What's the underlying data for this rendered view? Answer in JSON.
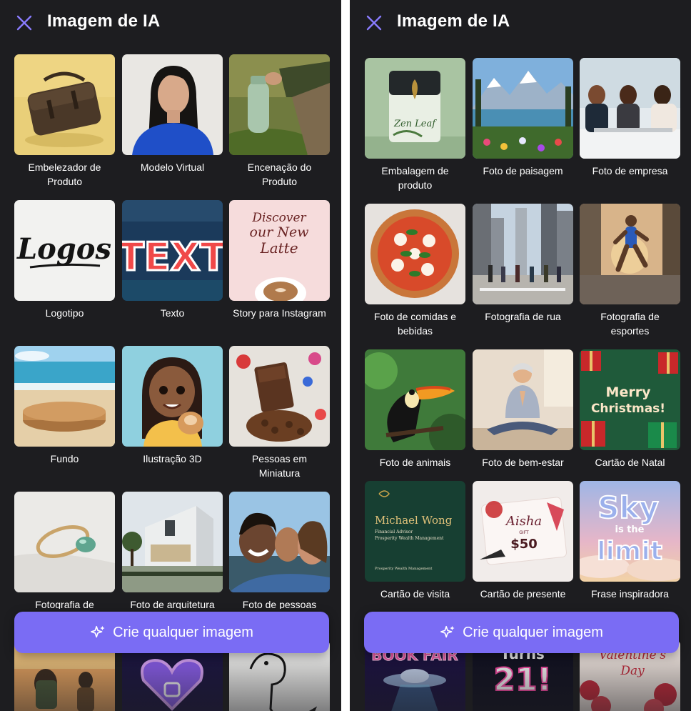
{
  "left": {
    "title": "Imagem de IA",
    "tiles": [
      {
        "label": "Embelezador de Produto"
      },
      {
        "label": "Modelo Virtual"
      },
      {
        "label": "Encenação do Produto"
      },
      {
        "label": "Logotipo",
        "art_text": "Logos"
      },
      {
        "label": "Texto",
        "art_text": "TEXT"
      },
      {
        "label": "Story para Instagram",
        "art_lines": [
          "Discover",
          "our New",
          "Latte"
        ]
      },
      {
        "label": "Fundo"
      },
      {
        "label": "Ilustração 3D"
      },
      {
        "label": "Pessoas em Miniatura"
      },
      {
        "label": "Fotografia de"
      },
      {
        "label": "Foto de arquitetura"
      },
      {
        "label": "Foto de pessoas"
      }
    ],
    "cta_label": "Crie qualquer imagem"
  },
  "right": {
    "title": "Imagem de IA",
    "tiles": [
      {
        "label": "Embalagem de produto",
        "art_text": "Zen Leaf"
      },
      {
        "label": "Foto de paisagem"
      },
      {
        "label": "Foto de empresa"
      },
      {
        "label": "Foto de comidas e bebidas"
      },
      {
        "label": "Fotografia de rua"
      },
      {
        "label": "Fotografia de esportes"
      },
      {
        "label": "Foto de animais"
      },
      {
        "label": "Foto de bem-estar"
      },
      {
        "label": "Cartão de Natal",
        "art_lines": [
          "Merry",
          "Christmas!"
        ]
      },
      {
        "label": "Cartão de visita",
        "art_lines": [
          "Michael Wong",
          "Financial Advisor",
          "Prosperity Wealth Management",
          "Prosperity Wealth Management"
        ]
      },
      {
        "label": "Cartão de presente",
        "art_lines": [
          "Aisha",
          "GIFT",
          "$50"
        ]
      },
      {
        "label": "Frase inspiradora",
        "art_lines": [
          "Sky",
          "is the",
          "limit"
        ]
      }
    ],
    "peek_texts": [
      "BOOK FAIR",
      "Turns",
      "21!",
      "Valentine's",
      "Day"
    ],
    "cta_label": "Crie qualquer imagem"
  },
  "colors": {
    "panel_bg": "#1d1d20",
    "accent": "#7a6cf4",
    "close_icon": "#8a7cff",
    "text": "#ffffff"
  },
  "icons": {
    "close": "close-icon",
    "sparkle": "sparkle-icon"
  }
}
